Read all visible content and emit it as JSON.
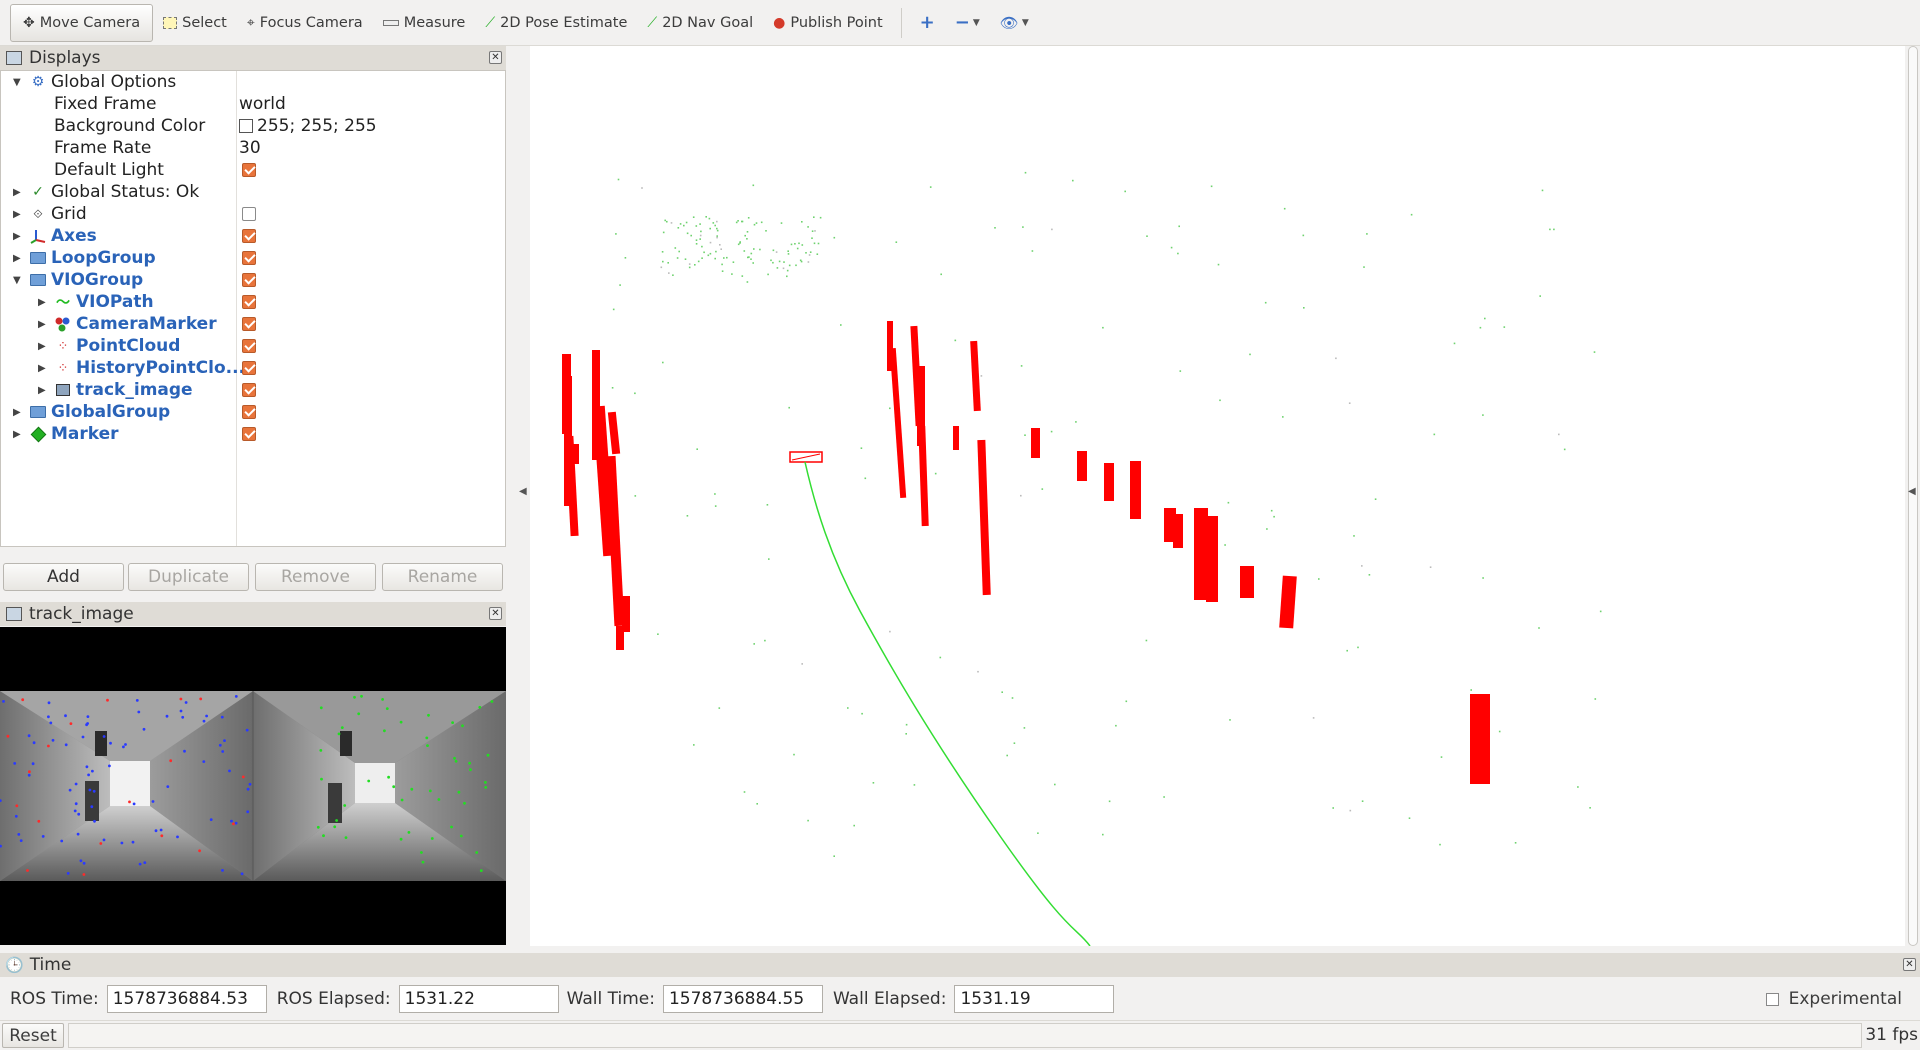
{
  "toolbar": {
    "tools": [
      {
        "label": "Move Camera",
        "icon": "move-camera-icon",
        "active": true
      },
      {
        "label": "Select",
        "icon": "select-icon"
      },
      {
        "label": "Focus Camera",
        "icon": "focus-camera-icon"
      },
      {
        "label": "Measure",
        "icon": "measure-icon"
      },
      {
        "label": "2D Pose Estimate",
        "icon": "pose-estimate-icon"
      },
      {
        "label": "2D Nav Goal",
        "icon": "nav-goal-icon"
      },
      {
        "label": "Publish Point",
        "icon": "publish-point-icon"
      }
    ]
  },
  "displays": {
    "title": "Displays",
    "global_options": {
      "label": "Global Options",
      "fixed_frame": {
        "label": "Fixed Frame",
        "value": "world"
      },
      "background_color": {
        "label": "Background Color",
        "value": "255; 255; 255"
      },
      "frame_rate": {
        "label": "Frame Rate",
        "value": "30"
      },
      "default_light": {
        "label": "Default Light",
        "checked": true
      }
    },
    "global_status": "Global Status: Ok",
    "items": [
      {
        "label": "Grid",
        "checked": false
      },
      {
        "label": "Axes",
        "checked": true
      },
      {
        "label": "LoopGroup",
        "checked": true
      },
      {
        "label": "VIOGroup",
        "checked": true
      },
      {
        "label": "VIOPath",
        "checked": true
      },
      {
        "label": "CameraMarker",
        "checked": true
      },
      {
        "label": "PointCloud",
        "checked": true
      },
      {
        "label": "HistoryPointClo...",
        "checked": true
      },
      {
        "label": "track_image",
        "checked": true
      },
      {
        "label": "GlobalGroup",
        "checked": true
      },
      {
        "label": "Marker",
        "checked": true
      }
    ],
    "buttons": {
      "add": "Add",
      "duplicate": "Duplicate",
      "remove": "Remove",
      "rename": "Rename"
    }
  },
  "track_image_panel": {
    "title": "track_image"
  },
  "time": {
    "title": "Time",
    "ros_time_label": "ROS Time:",
    "ros_time": "1578736884.53",
    "ros_elapsed_label": "ROS Elapsed:",
    "ros_elapsed": "1531.22",
    "wall_time_label": "Wall Time:",
    "wall_time": "1578736884.55",
    "wall_elapsed_label": "Wall Elapsed:",
    "wall_elapsed": "1531.19",
    "experimental": "Experimental"
  },
  "status": {
    "reset": "Reset",
    "fps": "31 fps"
  },
  "colors": {
    "marker": "#ff0000",
    "path": "#33dd33",
    "accent": "#2a63b8",
    "checkbox": "#e8743b"
  }
}
